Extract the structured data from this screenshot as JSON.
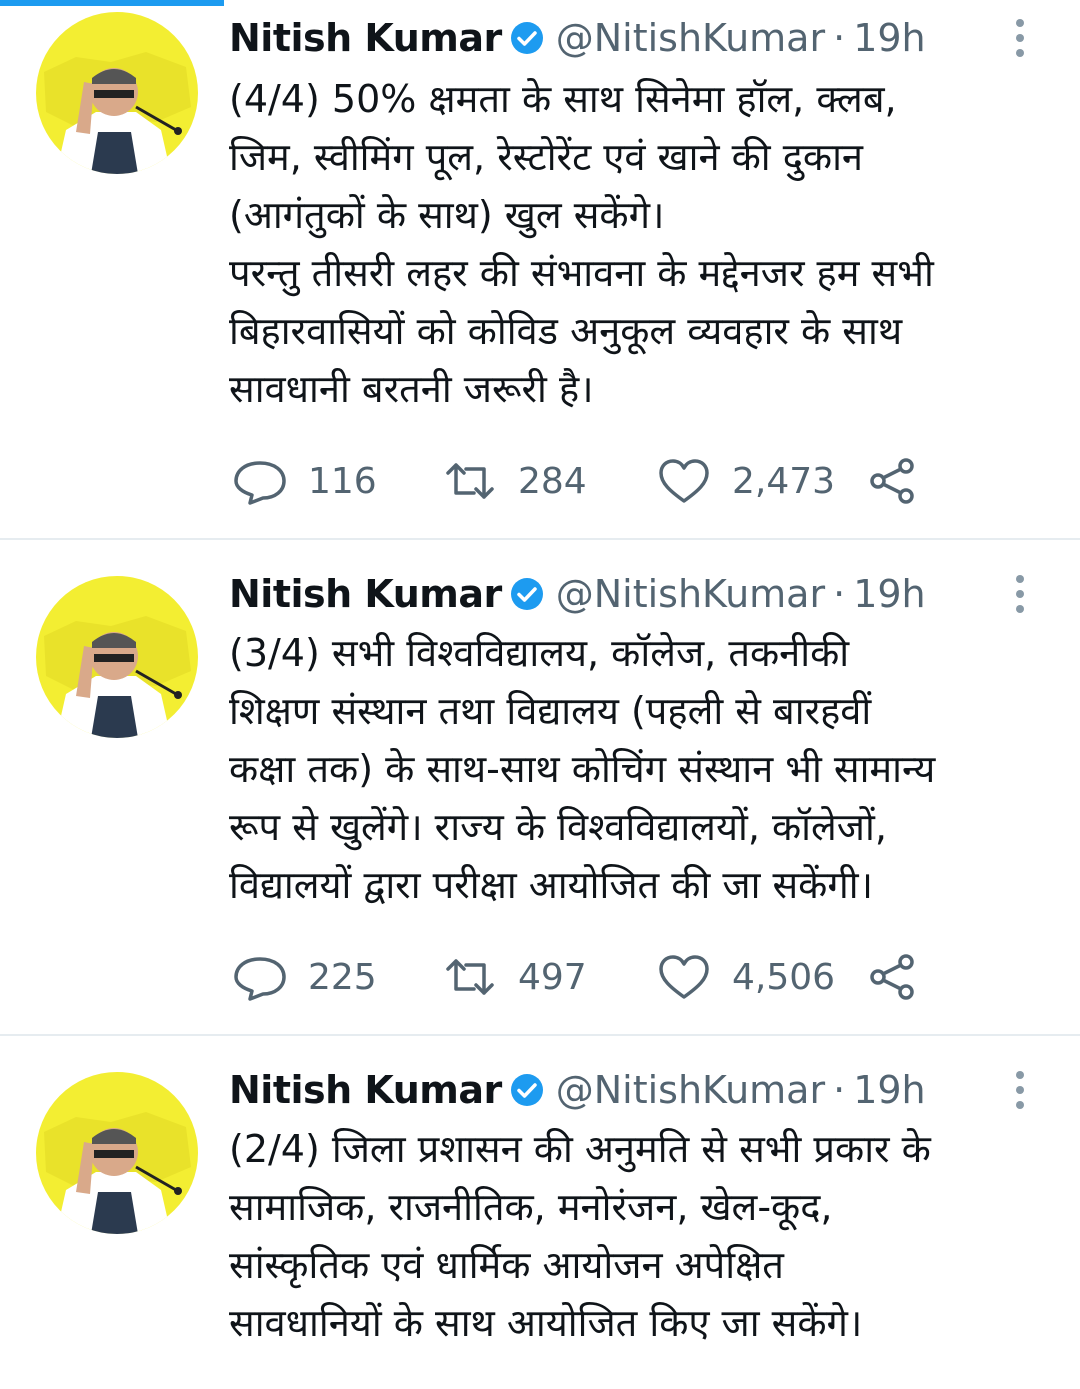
{
  "colors": {
    "accent": "#1d9bf0",
    "secondary_text": "#536471",
    "divider": "#e6ecf0",
    "avatar_bg": "#f3ee32"
  },
  "tweets": [
    {
      "author": {
        "name": "Nitish Kumar",
        "handle": "@NitishKumar",
        "verified": true
      },
      "separator": "·",
      "time": "19h",
      "lines": [
        "(4/4) 50% क्षमता के साथ सिनेमा हॉल, क्लब,",
        "जिम, स्वीमिंग पूल, रेस्टोरेंट एवं खाने की दुकान",
        "(आगंतुकों के साथ) खुल सकेंगे।",
        "परन्तु तीसरी लहर की संभावना के मद्देनजर हम सभी",
        "बिहारवासियों को कोविड अनुकूल व्यवहार के साथ",
        "सावधानी बरतनी जरूरी है।"
      ],
      "stats": {
        "replies": "116",
        "retweets": "284",
        "likes": "2,473"
      }
    },
    {
      "author": {
        "name": "Nitish Kumar",
        "handle": "@NitishKumar",
        "verified": true
      },
      "separator": "·",
      "time": "19h",
      "lines": [
        "(3/4) सभी विश्वविद्यालय, कॉलेज, तकनीकी",
        "शिक्षण संस्थान तथा विद्यालय (पहली से बारहवीं",
        "कक्षा तक) के साथ-साथ कोचिंग संस्थान भी सामान्य",
        "रूप से खुलेंगे। राज्य के विश्वविद्यालयों, कॉलेजों,",
        "विद्यालयों द्वारा परीक्षा आयोजित की जा सकेंगी।"
      ],
      "stats": {
        "replies": "225",
        "retweets": "497",
        "likes": "4,506"
      }
    },
    {
      "author": {
        "name": "Nitish Kumar",
        "handle": "@NitishKumar",
        "verified": true
      },
      "separator": "·",
      "time": "19h",
      "lines": [
        "(2/4) जिला प्रशासन की अनुमति से सभी प्रकार के",
        "सामाजिक, राजनीतिक, मनोरंजन, खेल-कूद,",
        "सांस्कृतिक एवं धार्मिक आयोजन अपेक्षित",
        "सावधानियों के साथ आयोजित किए जा सकेंगे।"
      ]
    }
  ]
}
